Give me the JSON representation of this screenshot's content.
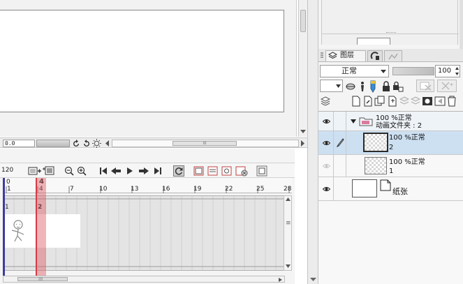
{
  "canvas": {
    "zoom_value": "0.0",
    "hscroll_grip": "III"
  },
  "timeline": {
    "fps": "120",
    "current_frame_marker": "4",
    "ruler_top": [
      "0",
      "1",
      "4",
      "7",
      "10",
      "13",
      "16",
      "19",
      "22",
      "25",
      "28"
    ],
    "ruler_bottom": [
      "1",
      "4"
    ],
    "track_cells": [
      "1",
      "2"
    ],
    "scroll_grip": "III",
    "vscroll_grip": "≡"
  },
  "layers_panel": {
    "tab_label": "图层",
    "blend_mode": "正常",
    "opacity": "100",
    "folder": {
      "name_line1": "100 %正常",
      "name_line2": "动画文件夹 : 2"
    },
    "layers": [
      {
        "name": "100 %正常",
        "frame": "2",
        "selected": true
      },
      {
        "name": "100 %正常",
        "frame": "1",
        "selected": false
      }
    ],
    "paper_layer": "纸张"
  },
  "icons": {
    "eye": "eye-icon",
    "pen": "pen-icon",
    "folder": "folder-icon",
    "accent_red": "#d63b45",
    "selection_blue": "#cde0f2"
  }
}
